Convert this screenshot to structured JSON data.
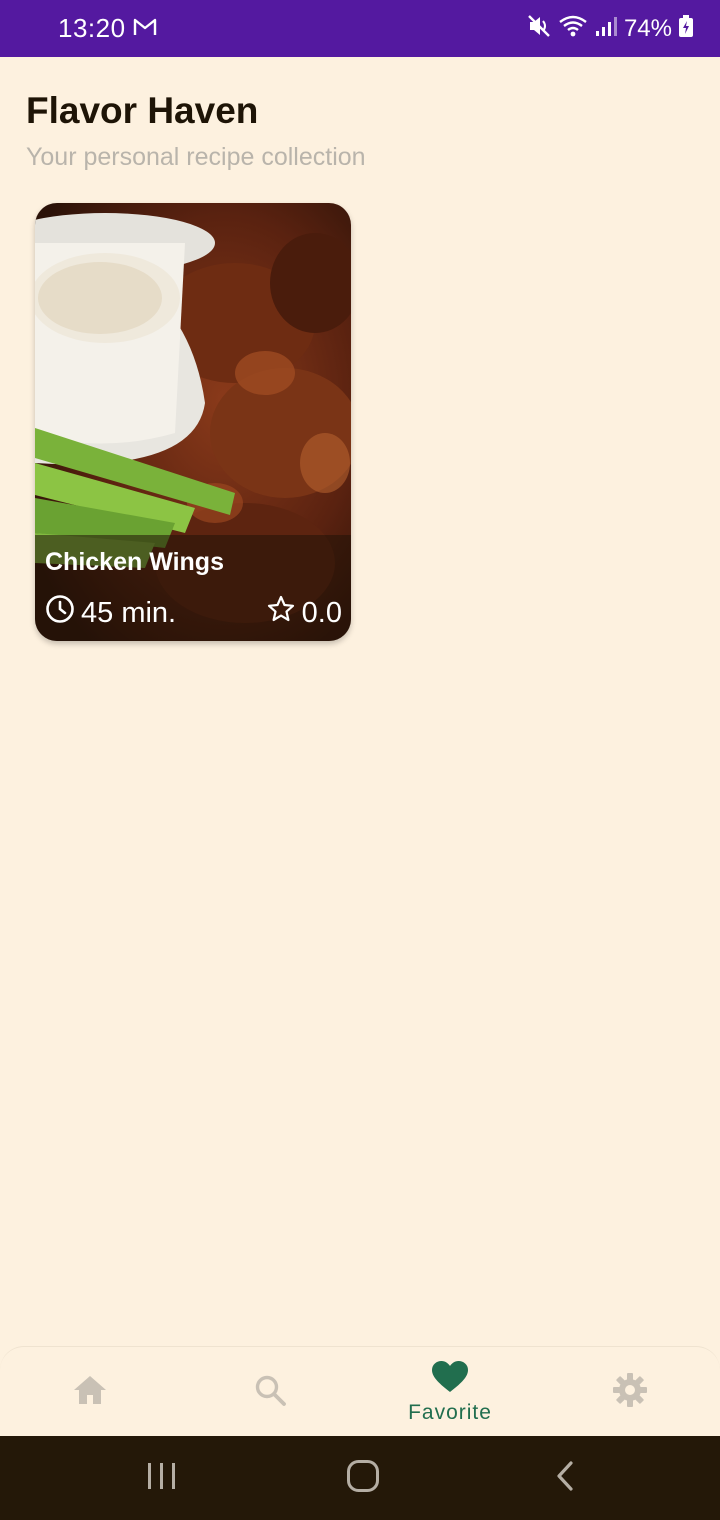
{
  "status_bar": {
    "time": "13:20",
    "battery_percent": "74%",
    "icons": [
      "gmail-icon",
      "mute-icon",
      "wifi-icon",
      "signal-icon",
      "battery-charging-icon"
    ]
  },
  "header": {
    "title": "Flavor Haven",
    "subtitle": "Your personal recipe collection"
  },
  "recipes": [
    {
      "title": "Chicken Wings",
      "time": "45 min.",
      "rating": "0.0",
      "time_icon": "clock-icon",
      "rating_icon": "star-outline-icon"
    }
  ],
  "bottom_nav": {
    "items": [
      {
        "icon": "home-icon",
        "label": "",
        "active": false
      },
      {
        "icon": "search-icon",
        "label": "",
        "active": false
      },
      {
        "icon": "heart-icon",
        "label": "Favorite",
        "active": true
      },
      {
        "icon": "gear-icon",
        "label": "",
        "active": false
      }
    ]
  },
  "system_nav": {
    "icons": [
      "recents-icon",
      "home-circle-icon",
      "back-icon"
    ]
  },
  "colors": {
    "status_bar": "#5419a0",
    "background": "#fdf1df",
    "accent": "#216e4e",
    "inactive_icon": "#c9c1b5",
    "system_nav": "#241808"
  }
}
